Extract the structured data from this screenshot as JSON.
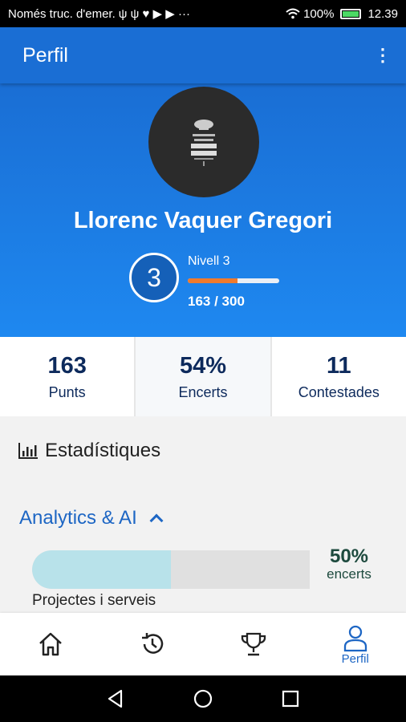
{
  "status_bar": {
    "carrier": "Només truc. d'emer.",
    "notif_icons": "ψ ψ ♥ ▶ ▶ ···",
    "battery": "100%",
    "time": "12.39"
  },
  "app_bar": {
    "title": "Perfil"
  },
  "profile": {
    "name": "Llorenc Vaquer Gregori",
    "level_number": "3",
    "level_label": "Nivell 3",
    "level_points": "163 / 300",
    "level_progress": 0.54
  },
  "stats": [
    {
      "value": "163",
      "label": "Punts"
    },
    {
      "value": "54%",
      "label": "Encerts"
    },
    {
      "value": "11",
      "label": "Contestades"
    }
  ],
  "statistics": {
    "title": "Estadístiques",
    "category": "Analytics & AI",
    "subcategory": "Projectes i serveis",
    "percent_text": "50%",
    "percent_label": "encerts",
    "percent_value": 0.5
  },
  "bottom_nav": {
    "active": "profile",
    "profile_label": "Perfil"
  },
  "colors": {
    "primary": "#1a6ed4",
    "accent": "#f07a2c",
    "stat_text": "#0d2a5c"
  },
  "icons": [
    "wifi-icon",
    "battery-icon",
    "more-vert-icon",
    "stats-icon",
    "chevron-up-icon",
    "home-icon",
    "history-icon",
    "trophy-icon",
    "person-icon",
    "back-icon",
    "home-circle-icon",
    "recents-icon"
  ]
}
